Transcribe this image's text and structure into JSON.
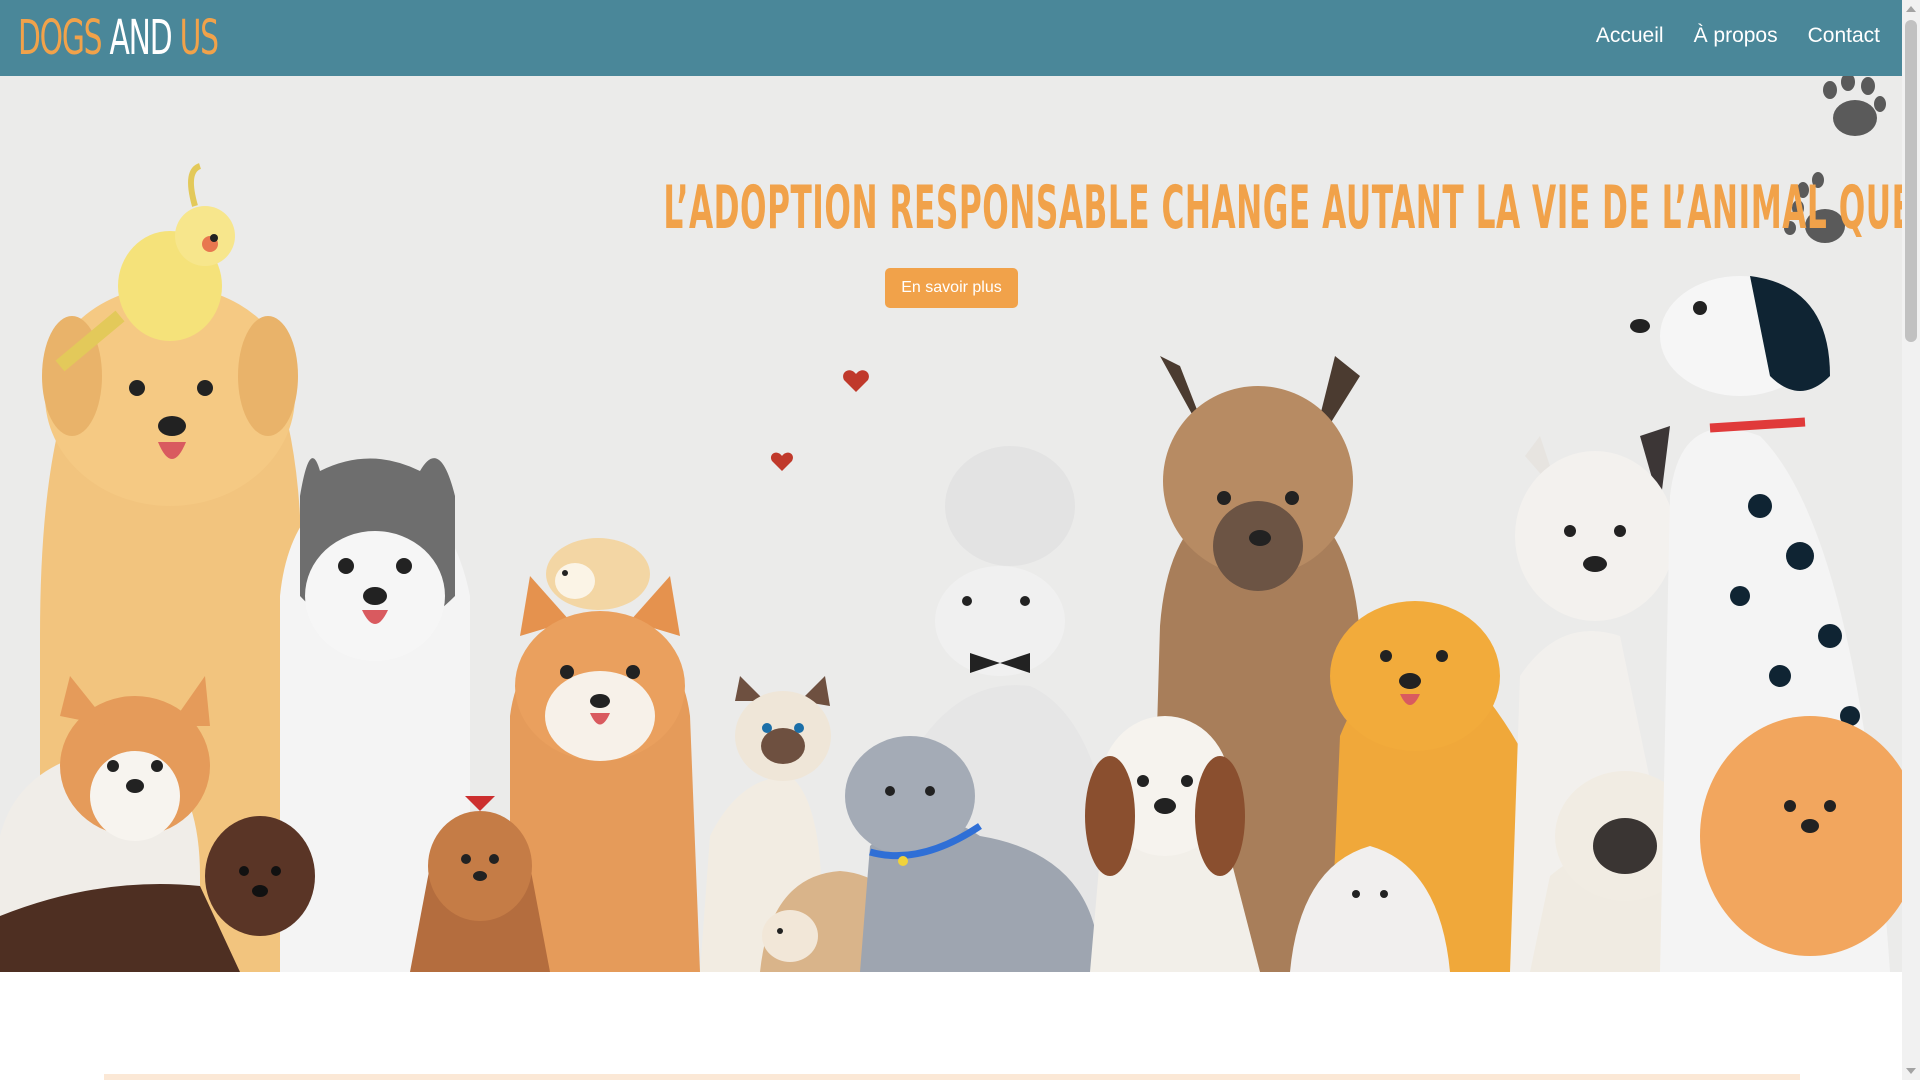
{
  "brand": {
    "part1": "DOGS",
    "part2": "AND",
    "part3": "US"
  },
  "nav": {
    "home": "Accueil",
    "about": "À propos",
    "contact": "Contact"
  },
  "hero": {
    "headline": "L’adoption responsable change autant la vie de l’animal que la vôtre",
    "cta_label": "En savoir plus"
  },
  "colors": {
    "navbar": "#4a8799",
    "accent": "#f1a24a",
    "hero_bg": "#ebebea",
    "white": "#ffffff"
  }
}
